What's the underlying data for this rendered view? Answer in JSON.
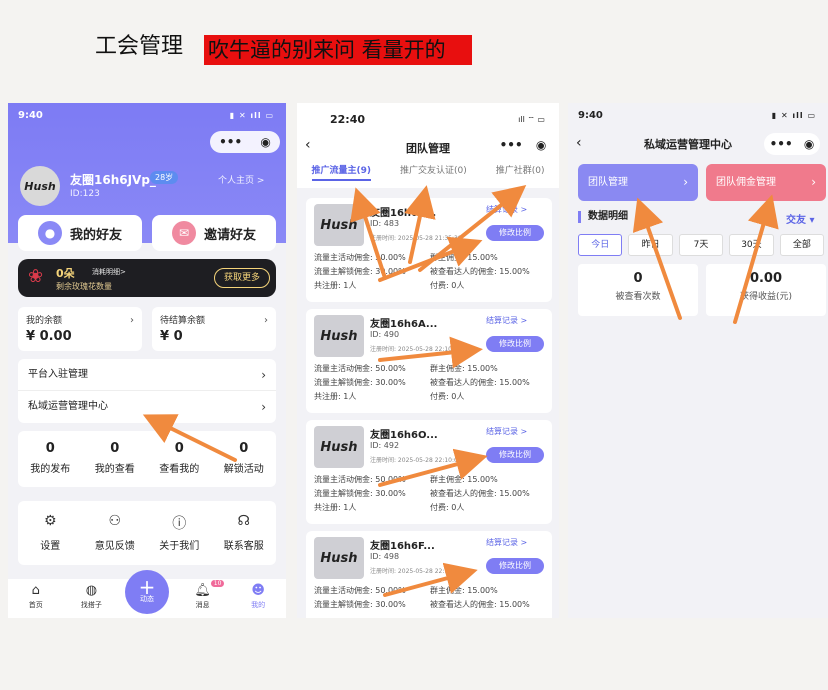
{
  "header": {
    "title": "工会管理",
    "banner": "吹牛逼的别来问 看量开的"
  },
  "colors": {
    "accent": "#7f7df4",
    "banner_bg": "#e80f0f",
    "arrow": "#f08a3e",
    "pink": "#f07a8c"
  },
  "phone1": {
    "time": "9:40",
    "user": {
      "avatar_text": "Hush",
      "name": "友圈16h6JVp_",
      "badge": "28岁",
      "id": "ID:123",
      "home_link": "个人主页 >"
    },
    "buttons": {
      "friends": "我的好友",
      "invite": "邀请好友"
    },
    "roses": {
      "count": "0朵",
      "record": "消耗明细>",
      "remain": "剩余玫瑰花数量",
      "get_more": "获取更多"
    },
    "balance": {
      "label": "我的余额",
      "value": "¥ 0.00"
    },
    "pending": {
      "label": "待结算余额",
      "value": "¥ 0"
    },
    "menu": [
      "平台入驻管理",
      "私域运营管理中心"
    ],
    "stats": [
      {
        "value": "0",
        "label": "我的发布"
      },
      {
        "value": "0",
        "label": "我的查看"
      },
      {
        "value": "0",
        "label": "查看我的"
      },
      {
        "value": "0",
        "label": "解锁活动"
      }
    ],
    "tools": [
      {
        "icon": "settings-icon",
        "label": "设置"
      },
      {
        "icon": "feedback-icon",
        "label": "意见反馈"
      },
      {
        "icon": "info-icon",
        "label": "关于我们"
      },
      {
        "icon": "headset-icon",
        "label": "联系客服"
      }
    ],
    "tabbar": [
      {
        "icon": "home-icon",
        "label": "首页"
      },
      {
        "icon": "planet-icon",
        "label": "找搭子"
      },
      {
        "icon": "plus-icon",
        "label": "动态"
      },
      {
        "icon": "bell-icon",
        "label": "消息",
        "badge": "10"
      },
      {
        "icon": "profile-icon",
        "label": "我的"
      }
    ]
  },
  "phone2": {
    "time": "22:40",
    "title": "团队管理",
    "tabs": [
      "推广流量主(9)",
      "推广交友认证(0)",
      "推广社群(0)"
    ],
    "record_label": "结算记录 >",
    "edit_label": "修改比例",
    "members": [
      {
        "name": "友圈16h6E...",
        "id": "ID: 483",
        "reg": "注册时间: 2025-05-28 21:35:39",
        "act": "流量主活动佣金: 50.00%",
        "group": "群主佣金: 15.00%",
        "unlock": "流量主解锁佣金: 30.00%",
        "viewed": "被查看达人的佣金: 15.00%",
        "total": "共注册: 1人",
        "paid": "付费: 0人"
      },
      {
        "name": "友圈16h6A...",
        "id": "ID: 490",
        "reg": "注册时间: 2025-05-28 22:10:04",
        "act": "流量主活动佣金: 50.00%",
        "group": "群主佣金: 15.00%",
        "unlock": "流量主解锁佣金: 30.00%",
        "viewed": "被查看达人的佣金: 15.00%",
        "total": "共注册: 1人",
        "paid": "付费: 0人"
      },
      {
        "name": "友圈16h6O...",
        "id": "ID: 492",
        "reg": "注册时间: 2025-05-28 22:10:08",
        "act": "流量主活动佣金: 50.00%",
        "group": "群主佣金: 15.00%",
        "unlock": "流量主解锁佣金: 30.00%",
        "viewed": "被查看达人的佣金: 15.00%",
        "total": "共注册: 1人",
        "paid": "付费: 0人"
      },
      {
        "name": "友圈16h6F...",
        "id": "ID: 498",
        "reg": "注册时间: 2025-05-28 22:17:16",
        "act": "流量主活动佣金: 50.00%",
        "group": "群主佣金: 15.00%",
        "unlock": "流量主解锁佣金: 30.00%",
        "viewed": "被查看达人的佣金: 15.00%",
        "total": "",
        "paid": ""
      }
    ]
  },
  "phone3": {
    "time": "9:40",
    "title": "私域运营管理中心",
    "team_btn": "团队管理",
    "commission_btn": "团队佣金管理",
    "section": "数据明细",
    "filter": "交友 ▾",
    "periods": [
      "今日",
      "昨日",
      "7天",
      "30天",
      "全部"
    ],
    "metrics": [
      {
        "value": "0",
        "label": "被查看次数"
      },
      {
        "value": "0.00",
        "label": "获得收益(元)"
      }
    ]
  }
}
